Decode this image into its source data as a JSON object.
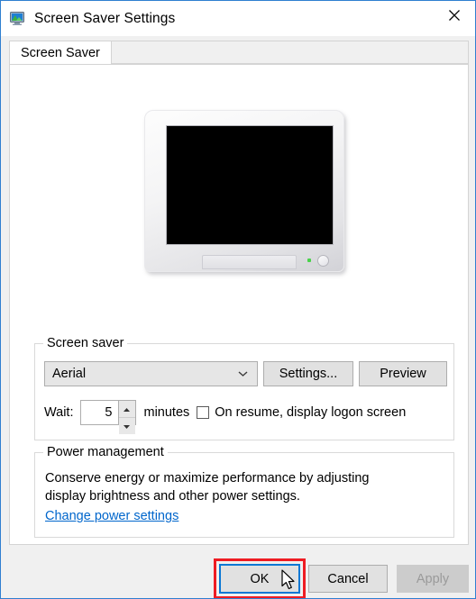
{
  "window": {
    "title": "Screen Saver Settings",
    "icon": "monitor-icon",
    "close_icon": "close-icon",
    "border_color": "#2f7fd0"
  },
  "tabs": [
    {
      "label": "Screen Saver",
      "selected": true
    }
  ],
  "preview": {
    "monitor_icon": "monitor-preview",
    "screen_color": "#000000",
    "led_color": "#49d24a"
  },
  "screen_saver_group": {
    "legend": "Screen saver",
    "dropdown": {
      "value": "Aerial",
      "arrow_icon": "chevron-down-icon"
    },
    "settings_button": "Settings...",
    "preview_button": "Preview",
    "wait_label": "Wait:",
    "wait_value": "5",
    "minutes_label": "minutes",
    "spin_up_icon": "triangle-up-icon",
    "spin_down_icon": "triangle-down-icon",
    "checkbox_label": "On resume, display logon screen",
    "checkbox_checked": false
  },
  "power_group": {
    "legend": "Power management",
    "description": "Conserve energy or maximize performance by adjusting display brightness and other power settings.",
    "link": "Change power settings",
    "link_color": "#0066cc"
  },
  "footer": {
    "ok_label": "OK",
    "cancel_label": "Cancel",
    "apply_label": "Apply",
    "apply_disabled": true,
    "ok_focused": true,
    "annotation_color": "#ee1c23",
    "focus_color": "#0a78d4",
    "cursor_icon": "mouse-pointer-icon"
  }
}
